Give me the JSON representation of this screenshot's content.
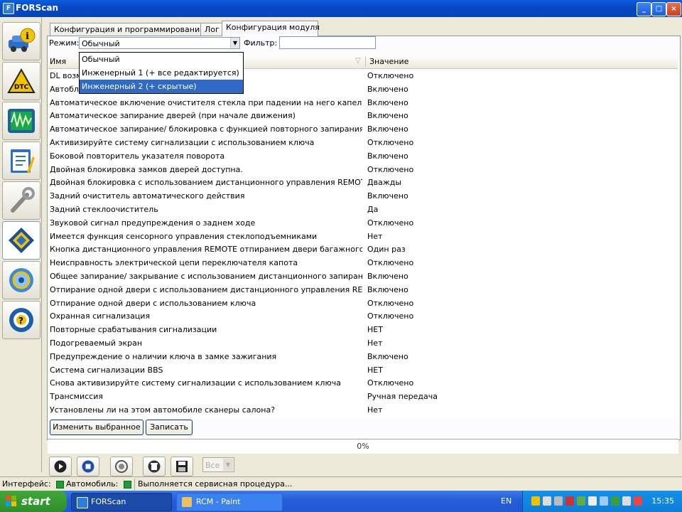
{
  "window": {
    "title": "FORScan"
  },
  "sidebar": {
    "icons": [
      "car-info-icon",
      "dtc-icon",
      "oscilloscope-icon",
      "checklist-icon",
      "wrench-icon",
      "chip-icon",
      "gear-icon",
      "help-icon"
    ],
    "dtc_label": "DTC"
  },
  "tabs": [
    {
      "label": "Конфигурация и программирование"
    },
    {
      "label": "Лог"
    },
    {
      "label": "Конфигурация модуля"
    }
  ],
  "toolbar": {
    "mode_label": "Режим:",
    "mode_value": "Обычный",
    "filter_label": "Фильтр:",
    "filter_value": ""
  },
  "mode_options": [
    {
      "label": "Обычный"
    },
    {
      "label": "Инженерный 1 (+ все редактируется)"
    },
    {
      "label": "Инженерный 2 (+ скрытые)"
    }
  ],
  "table": {
    "columns": [
      "Имя",
      "Значение"
    ],
    "rows": [
      {
        "name": "DL возм",
        "value": "Отключено"
      },
      {
        "name": "Автобл",
        "value": "Включено"
      },
      {
        "name": "Автоматическое включение очистителя стекла при падении на него капель",
        "value": "Включено"
      },
      {
        "name": "Автоматическое запирание дверей (при начале движения)",
        "value": "Включено"
      },
      {
        "name": "Автоматическое запирание/ блокировка с функцией повторного запирания/ ...",
        "value": "Включено"
      },
      {
        "name": "Активизируйте систему сигнализации с использованием ключа",
        "value": "Отключено"
      },
      {
        "name": "Боковой повторитель указателя поворота",
        "value": "Включено"
      },
      {
        "name": "Двойная блокировка замков дверей доступна.",
        "value": "Отключено"
      },
      {
        "name": "Двойная блокировка с использованием дистанционного управления REMOTE",
        "value": "Дважды"
      },
      {
        "name": "Задний очиститель автоматического действия",
        "value": "Включено"
      },
      {
        "name": "Задний стеклоочиститель",
        "value": "Да"
      },
      {
        "name": "Звуковой сигнал предупреждения о заднем ходе",
        "value": "Отключено"
      },
      {
        "name": "Имеется функция сенсорного управления стеклоподъемниками",
        "value": "Нет"
      },
      {
        "name": "Кнопка дистанционного управления REMOTE отпиранием двери багажного о...",
        "value": "Один раз"
      },
      {
        "name": "Неисправность электрической цепи переключателя капота",
        "value": "Отключено"
      },
      {
        "name": "Общее запирание/ закрывание с использованием дистанционного запирани...",
        "value": "Включено"
      },
      {
        "name": "Отпирание одной двери с использованием дистанционного управления REM...",
        "value": "Включено"
      },
      {
        "name": "Отпирание одной двери с использованием ключа",
        "value": "Отключено"
      },
      {
        "name": "Охранная сигнализация",
        "value": "Отключено"
      },
      {
        "name": "Повторные срабатывания сигнализации",
        "value": "НЕТ"
      },
      {
        "name": "Подогреваемый экран",
        "value": "Нет"
      },
      {
        "name": "Предупреждение о наличии ключа в замке зажигания",
        "value": "Включено"
      },
      {
        "name": "Система сигнализации BBS",
        "value": "НЕТ"
      },
      {
        "name": "Снова активизируйте систему сигнализации с использованием ключа",
        "value": "Отключено"
      },
      {
        "name": "Трансмиссия",
        "value": "Ручная передача"
      },
      {
        "name": "Установлены ли на этом автомобиле сканеры салона?",
        "value": "Нет"
      }
    ]
  },
  "actions": {
    "edit_label": "Изменить выбранное",
    "write_label": "Записать"
  },
  "progress": {
    "text": "0%",
    "value": 0
  },
  "bottom_toolbar": {
    "icons": [
      "play-icon",
      "stop-icon",
      "reset-icon",
      "delete-icon",
      "save-icon"
    ],
    "scope_value": "Все"
  },
  "status": {
    "interface_label": "Интерфейс:",
    "vehicle_label": "Автомобиль:",
    "message": "Выполняется сервисная процедура...",
    "indicator_color": "#1e9c3a"
  },
  "taskbar": {
    "start_label": "start",
    "tasks": [
      {
        "label": "FORScan"
      },
      {
        "label": "RCM - Paint"
      }
    ],
    "lang": "EN",
    "clock": "15:35"
  }
}
